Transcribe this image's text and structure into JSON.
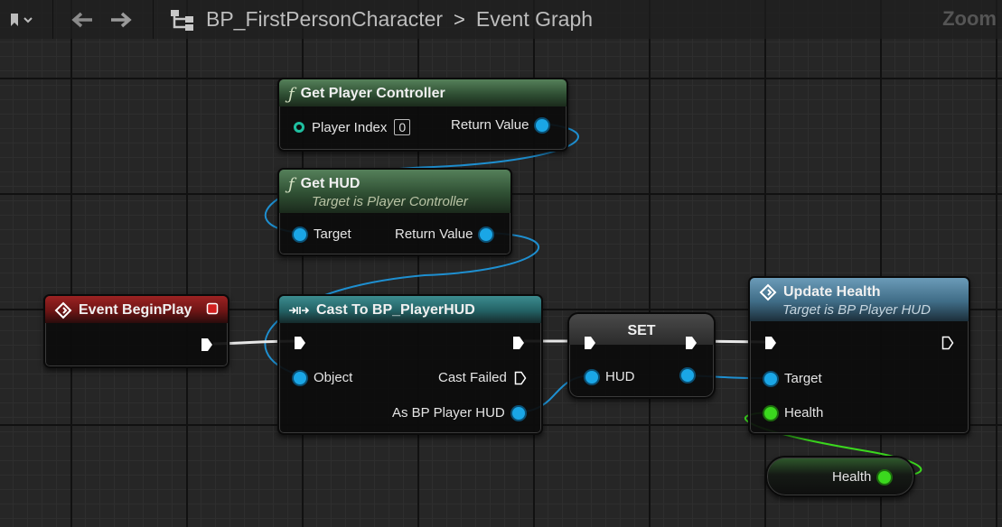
{
  "toolbar": {
    "bookmark_icon": "bookmark-icon",
    "back_icon": "arrow-left-icon",
    "forward_icon": "arrow-right-icon",
    "hierarchy_icon": "hierarchy-icon"
  },
  "breadcrumb": {
    "blueprint": "BP_FirstPersonCharacter",
    "separator": ">",
    "graph": "Event Graph"
  },
  "zoom_label": "Zoom",
  "nodes": {
    "get_player_controller": {
      "title": "Get Player Controller",
      "pin_in_label": "Player Index",
      "pin_in_value": "0",
      "pin_out_label": "Return Value"
    },
    "get_hud": {
      "title": "Get HUD",
      "subtitle": "Target is Player Controller",
      "pin_in_label": "Target",
      "pin_out_label": "Return Value"
    },
    "event_begin_play": {
      "title": "Event BeginPlay"
    },
    "cast_to_hud": {
      "title": "Cast To BP_PlayerHUD",
      "pin_object": "Object",
      "pin_cast_failed": "Cast Failed",
      "pin_as": "As BP Player HUD"
    },
    "set": {
      "title": "SET",
      "pin_hud": "HUD"
    },
    "update_health": {
      "title": "Update Health",
      "subtitle": "Target is BP Player HUD",
      "pin_target": "Target",
      "pin_health": "Health"
    },
    "health_var": {
      "label": "Health"
    }
  },
  "colors": {
    "object_pin": "#1aa6e6",
    "float_pin": "#3bd81e",
    "exec_wire": "#ffffff",
    "function_header": "#3f6b45",
    "event_header": "#8a1c1c",
    "cast_header": "#2d7376",
    "custom_function_header": "#4f7d98"
  }
}
